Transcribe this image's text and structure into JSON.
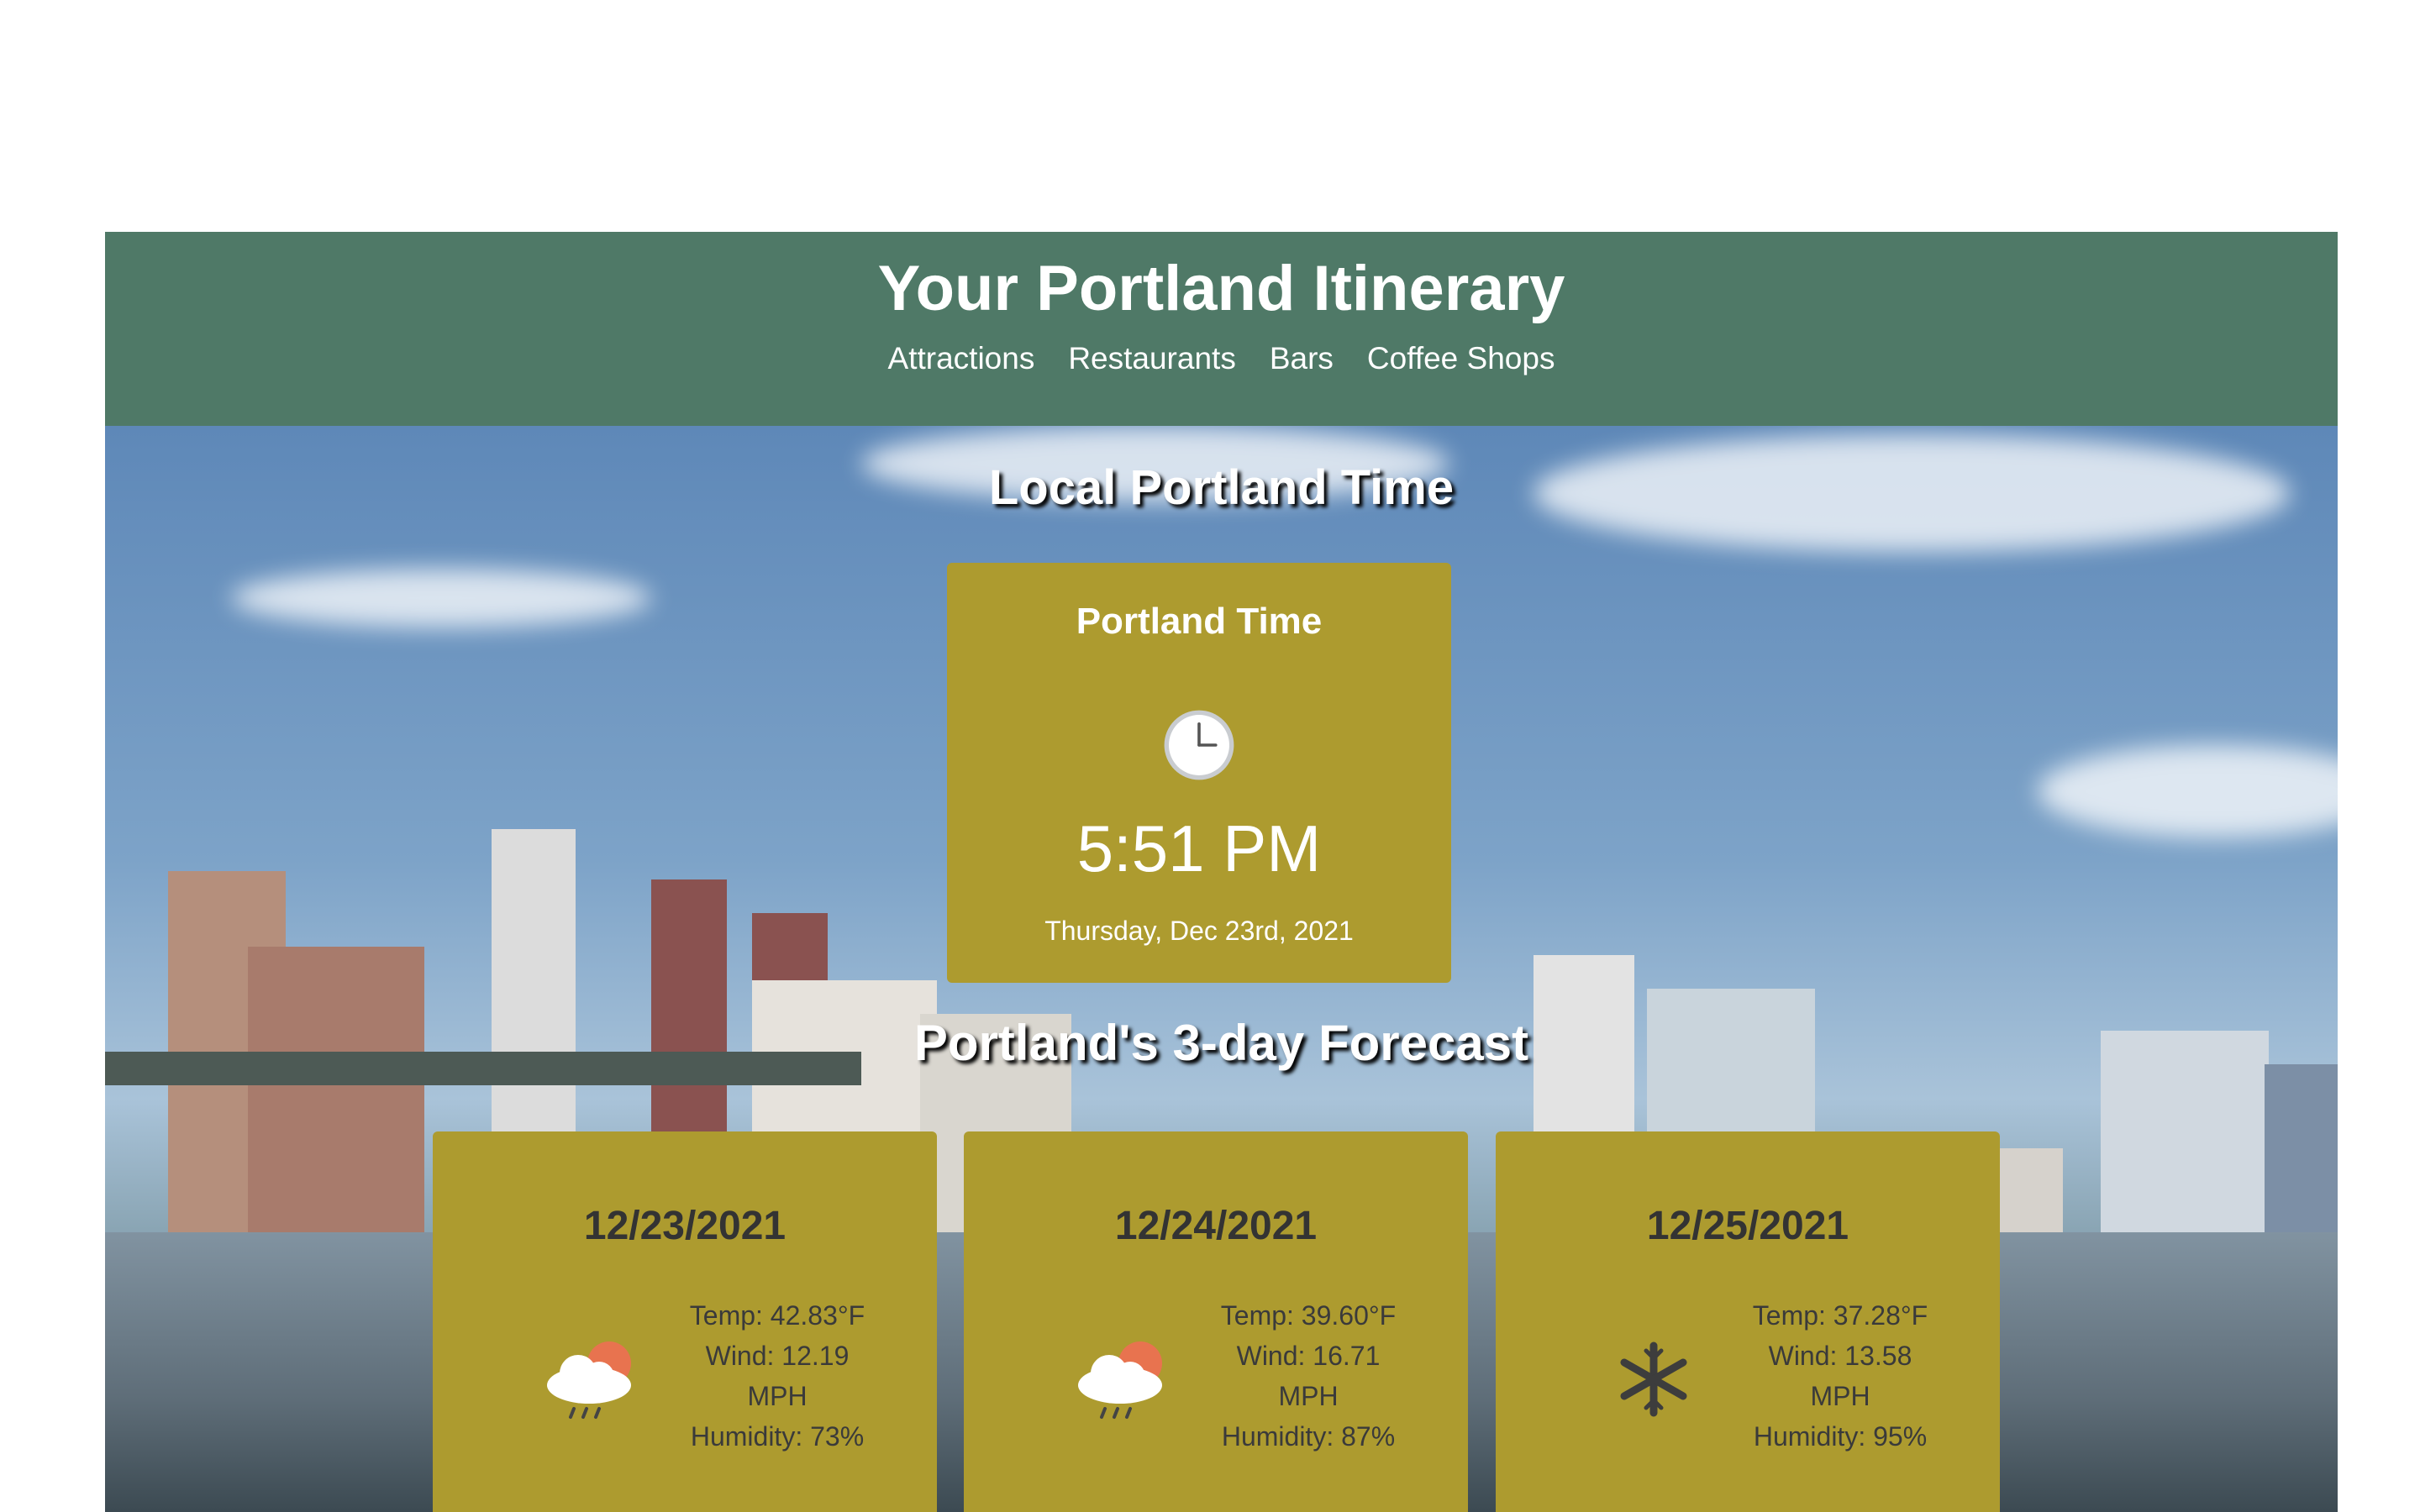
{
  "header": {
    "title": "Your Portland Itinerary",
    "nav": [
      "Attractions",
      "Restaurants",
      "Bars",
      "Coffee Shops"
    ]
  },
  "time_section": {
    "heading": "Local Portland Time",
    "card_title": "Portland Time",
    "icon": "clock-icon",
    "time": "5:51 PM",
    "date": "Thursday, Dec 23rd, 2021"
  },
  "forecast_section": {
    "heading": "Portland's 3-day Forecast",
    "days": [
      {
        "date": "12/23/2021",
        "icon": "rain-cloud-icon",
        "temp": "Temp: 42.83°F",
        "wind": "Wind: 12.19 MPH",
        "humidity": "Humidity: 73%"
      },
      {
        "date": "12/24/2021",
        "icon": "rain-cloud-icon",
        "temp": "Temp: 39.60°F",
        "wind": "Wind: 16.71 MPH",
        "humidity": "Humidity: 87%"
      },
      {
        "date": "12/25/2021",
        "icon": "snowflake-icon",
        "temp": "Temp: 37.28°F",
        "wind": "Wind: 13.58 MPH",
        "humidity": "Humidity: 95%"
      }
    ]
  },
  "colors": {
    "header_bg": "#4f7967",
    "card_bg": "#ad9b2f",
    "background": "#ffffff"
  }
}
